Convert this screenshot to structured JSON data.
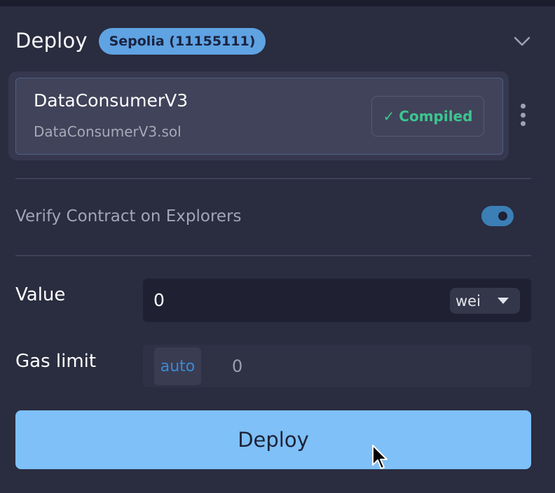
{
  "header": {
    "title": "Deploy",
    "network_badge": "Sepolia (11155111)",
    "collapse_icon": "chevron-down-icon"
  },
  "contract": {
    "name": "DataConsumerV3",
    "file": "DataConsumerV3.sol",
    "status_check": "✓",
    "status_label": "Compiled",
    "status_color": "#3cc68f",
    "menu_icon": "kebab-menu-icon"
  },
  "verify": {
    "label": "Verify Contract on Explorers",
    "enabled": true
  },
  "value_field": {
    "label": "Value",
    "value": "0",
    "unit": "wei"
  },
  "gas_field": {
    "label": "Gas limit",
    "mode": "auto",
    "value": "0"
  },
  "deploy_button": {
    "label": "Deploy"
  },
  "colors": {
    "background": "#2a2c3f",
    "accent": "#7ec0f7",
    "badge": "#5fa3e3"
  }
}
